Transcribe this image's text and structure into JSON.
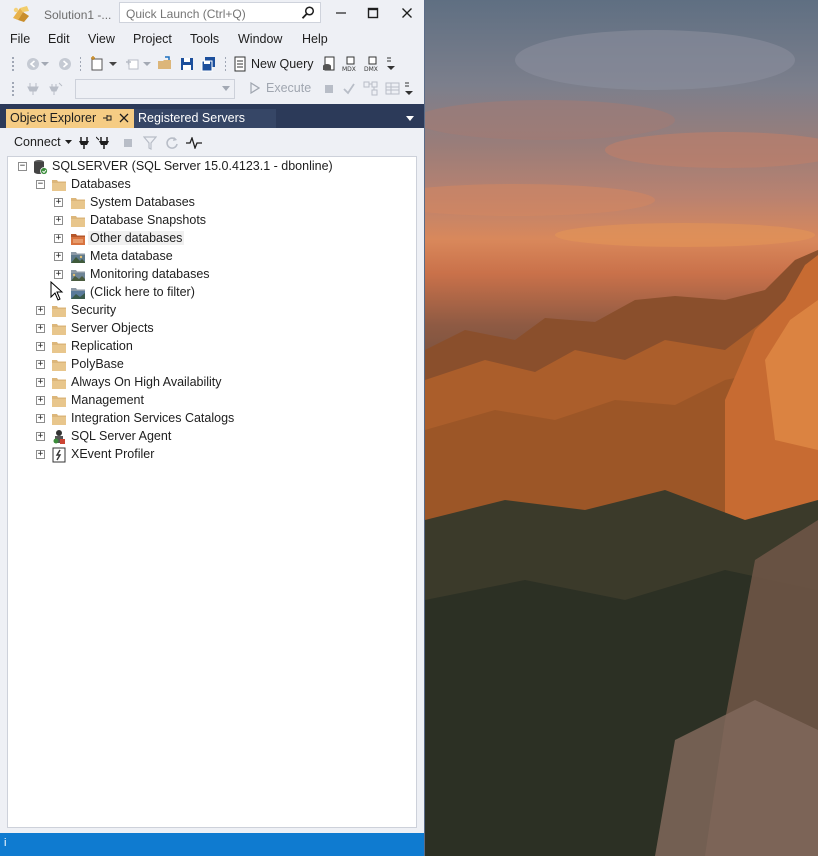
{
  "window": {
    "title": "Solution1 -...",
    "quick_launch_placeholder": "Quick Launch (Ctrl+Q)"
  },
  "menu": [
    "File",
    "Edit",
    "View",
    "Project",
    "Tools",
    "Window",
    "Help"
  ],
  "toolbar": {
    "new_query_label": "New Query",
    "execute_label": "Execute"
  },
  "tabs": {
    "object_explorer": "Object Explorer",
    "registered_servers": "Registered Servers"
  },
  "object_explorer": {
    "connect_label": "Connect",
    "server": "SQLSERVER (SQL Server 15.0.4123.1 - dbonline)",
    "databases": {
      "label": "Databases",
      "children": [
        {
          "label": "System Databases",
          "icon": "folder-icon"
        },
        {
          "label": "Database Snapshots",
          "icon": "folder-icon"
        },
        {
          "label": "Other databases",
          "icon": "orange-folder-icon"
        },
        {
          "label": "Meta database",
          "icon": "picture-folder-icon"
        },
        {
          "label": "Monitoring databases",
          "icon": "picture-folder-icon"
        },
        {
          "label": "(Click here to filter)",
          "icon": "picture-folder-icon"
        }
      ]
    },
    "top_level": [
      {
        "label": "Security",
        "icon": "folder-icon"
      },
      {
        "label": "Server Objects",
        "icon": "folder-icon"
      },
      {
        "label": "Replication",
        "icon": "folder-icon"
      },
      {
        "label": "PolyBase",
        "icon": "folder-icon"
      },
      {
        "label": "Always On High Availability",
        "icon": "folder-icon"
      },
      {
        "label": "Management",
        "icon": "folder-icon"
      },
      {
        "label": "Integration Services Catalogs",
        "icon": "folder-icon"
      },
      {
        "label": "SQL Server Agent",
        "icon": "agent-icon"
      },
      {
        "label": "XEvent Profiler",
        "icon": "xevent-icon"
      }
    ]
  },
  "colors": {
    "active_tab": "#f5cc84",
    "pane_header": "#2c3a59",
    "statusbar": "#0f7bd0",
    "folder": "#dcb67a"
  },
  "status": {
    "text": "i"
  }
}
